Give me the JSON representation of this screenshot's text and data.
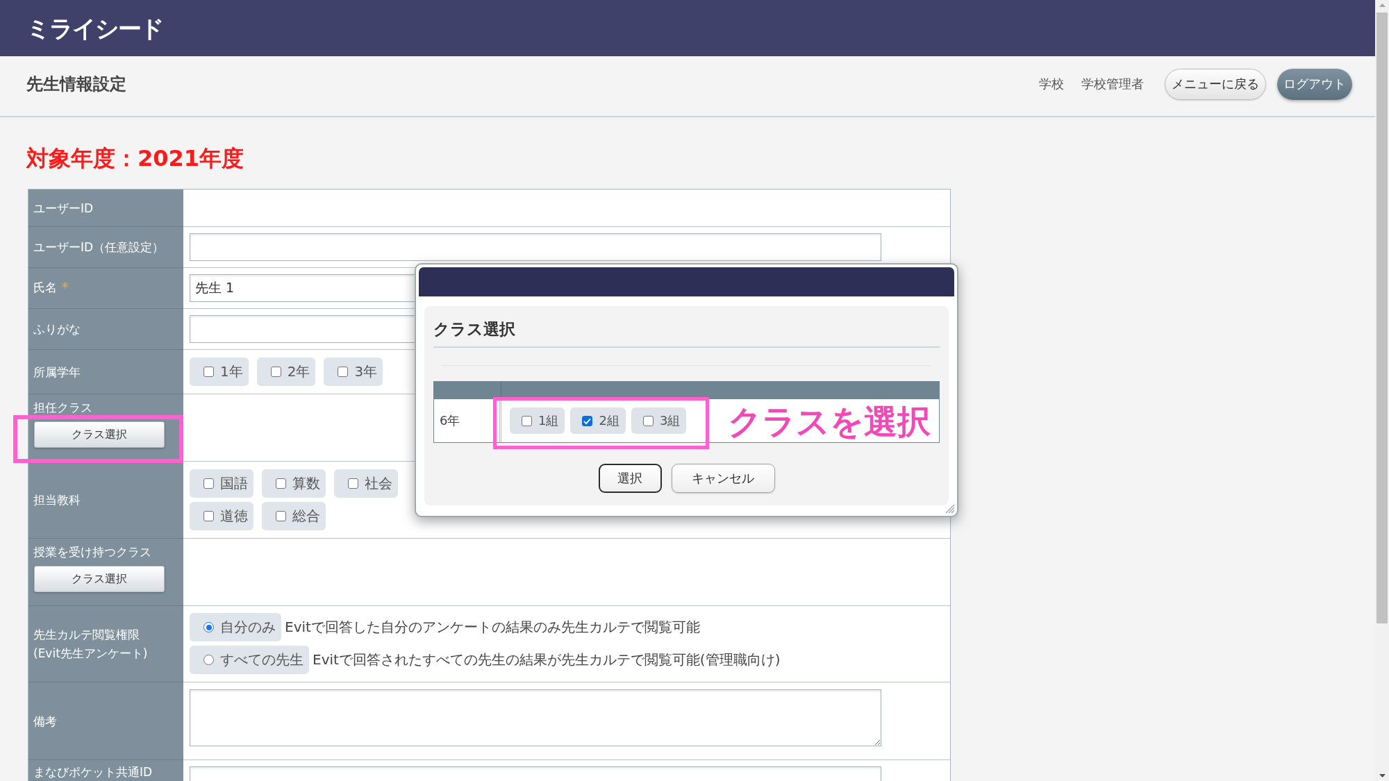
{
  "header": {
    "logo": "ミライシード"
  },
  "subheader": {
    "title": "先生情報設定",
    "links": [
      "学校",
      "学校管理者"
    ],
    "buttons": [
      {
        "label": "メニューに戻る",
        "kind": "secondary"
      },
      {
        "label": "ログアウト",
        "kind": "primary"
      }
    ]
  },
  "fiscal_year": "対象年度：2021年度",
  "form": {
    "rows": [
      {
        "label": "ユーザーID",
        "kind": "empty"
      },
      {
        "label": "ユーザーID（任意設定）",
        "kind": "input"
      },
      {
        "label": "氏名",
        "required_mark": "*",
        "kind": "input",
        "value": "先生 1"
      },
      {
        "label": "ふりがな",
        "kind": "input"
      },
      {
        "label": "所属学年",
        "kind": "checkboxes",
        "option_lines": [
          [
            {
              "label": "1年",
              "checked": false
            },
            {
              "label": "2年",
              "checked": false
            },
            {
              "label": "3年",
              "checked": false
            }
          ]
        ]
      },
      {
        "label": "担任クラス",
        "kind": "class_select",
        "button": "クラス選択",
        "highlighted": true
      },
      {
        "label": "担当教科",
        "kind": "checkboxes",
        "option_lines": [
          [
            {
              "label": "国語",
              "checked": false
            },
            {
              "label": "算数",
              "checked": false
            },
            {
              "label": "社会",
              "checked": false
            }
          ],
          [
            {
              "label": "道徳",
              "checked": false
            },
            {
              "label": "総合",
              "checked": false
            }
          ]
        ]
      },
      {
        "label": "授業を受け持つクラス",
        "kind": "class_select",
        "button": "クラス選択",
        "highlighted": false
      },
      {
        "label": "先生カルテ閲覧権限\n(Evit先生アンケート)",
        "kind": "radios",
        "options": [
          {
            "label": "自分のみ",
            "description": "Evitで回答した自分のアンケートの結果のみ先生カルテで閲覧可能",
            "selected": true
          },
          {
            "label": "すべての先生",
            "description": "Evitで回答されたすべての先生の結果が先生カルテで閲覧可能(管理職向け)",
            "selected": false
          }
        ]
      },
      {
        "label": "備考",
        "kind": "textarea"
      },
      {
        "label": "まなびポケット共通ID",
        "kind": "input"
      }
    ]
  },
  "dialog": {
    "title": "クラス選択",
    "rows": [
      {
        "grade": "6年",
        "highlighted": true,
        "annotation": "クラスを選択",
        "classes": [
          {
            "label": "1組",
            "checked": false
          },
          {
            "label": "2組",
            "checked": true
          },
          {
            "label": "3組",
            "checked": false
          }
        ]
      }
    ],
    "buttons": [
      {
        "label": "選択",
        "kind": "primary"
      },
      {
        "label": "キャンセル",
        "kind": "secondary"
      }
    ]
  }
}
